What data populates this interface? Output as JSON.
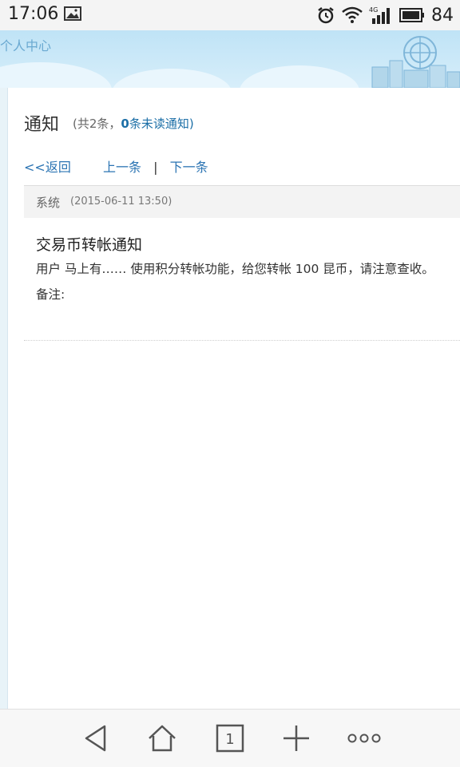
{
  "status_bar": {
    "time": "17:06",
    "network": "4G",
    "battery": "84",
    "icons": [
      "image-icon",
      "alarm-icon",
      "wifi-icon",
      "signal-icon",
      "battery-icon"
    ]
  },
  "header": {
    "title": "个人中心"
  },
  "notification": {
    "heading": "通知",
    "count_prefix": "(共2条，",
    "unread_count": "0",
    "unread_suffix": "条未读通知)",
    "back_link": "<<返回",
    "prev_link": "上一条",
    "separator": "|",
    "next_link": "下一条",
    "sender": "系统",
    "timestamp": "(2015-06-11 13:50)",
    "message_title": "交易币转帐通知",
    "message_body": "用户 马上有…… 使用积分转帐功能，给您转帐 100 昆币，请注意查收。",
    "note_label": "备注:"
  },
  "toolbar": {
    "tab_count": "1",
    "icons": [
      "back-icon",
      "home-icon",
      "tabs-icon",
      "add-icon",
      "more-icon"
    ]
  },
  "colors": {
    "link": "#2b74b3",
    "banner": "#c9e8f8"
  }
}
